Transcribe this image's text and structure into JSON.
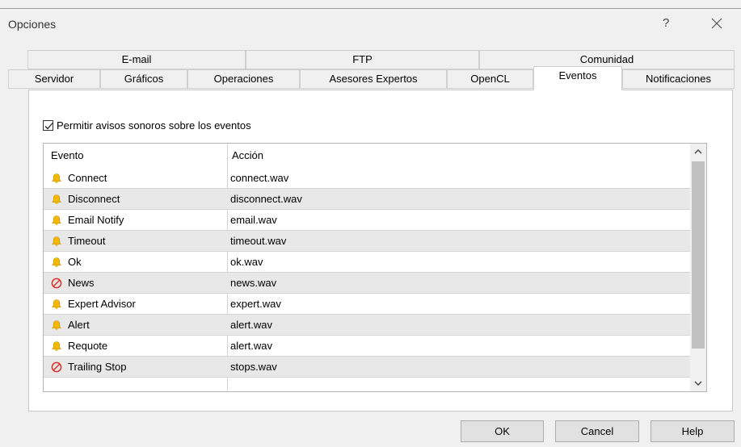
{
  "window": {
    "title": "Opciones",
    "help_glyph": "?"
  },
  "tabs": {
    "row1": [
      {
        "label": "E-mail"
      },
      {
        "label": "FTP"
      },
      {
        "label": "Comunidad"
      }
    ],
    "row2": [
      {
        "label": "Servidor"
      },
      {
        "label": "Gráficos"
      },
      {
        "label": "Operaciones"
      },
      {
        "label": "Asesores Expertos"
      },
      {
        "label": "OpenCL"
      },
      {
        "label": "Eventos",
        "active": true
      },
      {
        "label": "Notificaciones"
      }
    ]
  },
  "events_page": {
    "enable_sounds_label": "Permitir avisos sonoros sobre los eventos",
    "enable_sounds_checked": true,
    "columns": {
      "event": "Evento",
      "action": "Acción"
    },
    "rows": [
      {
        "event": "Connect",
        "action": "connect.wav",
        "icon": "bell-icon"
      },
      {
        "event": "Disconnect",
        "action": "disconnect.wav",
        "icon": "bell-icon"
      },
      {
        "event": "Email Notify",
        "action": "email.wav",
        "icon": "bell-icon"
      },
      {
        "event": "Timeout",
        "action": "timeout.wav",
        "icon": "bell-icon"
      },
      {
        "event": "Ok",
        "action": "ok.wav",
        "icon": "bell-icon"
      },
      {
        "event": "News",
        "action": "news.wav",
        "icon": "disabled-icon"
      },
      {
        "event": "Expert Advisor",
        "action": "expert.wav",
        "icon": "bell-icon"
      },
      {
        "event": "Alert",
        "action": "alert.wav",
        "icon": "bell-icon"
      },
      {
        "event": "Requote",
        "action": "alert.wav",
        "icon": "bell-icon"
      },
      {
        "event": "Trailing Stop",
        "action": "stops.wav",
        "icon": "disabled-icon"
      }
    ]
  },
  "buttons": {
    "ok": "OK",
    "cancel": "Cancel",
    "help": "Help"
  },
  "colors": {
    "bell": "#f5b800",
    "disabled": "#d9342b",
    "active_tab": "#ffffff"
  }
}
